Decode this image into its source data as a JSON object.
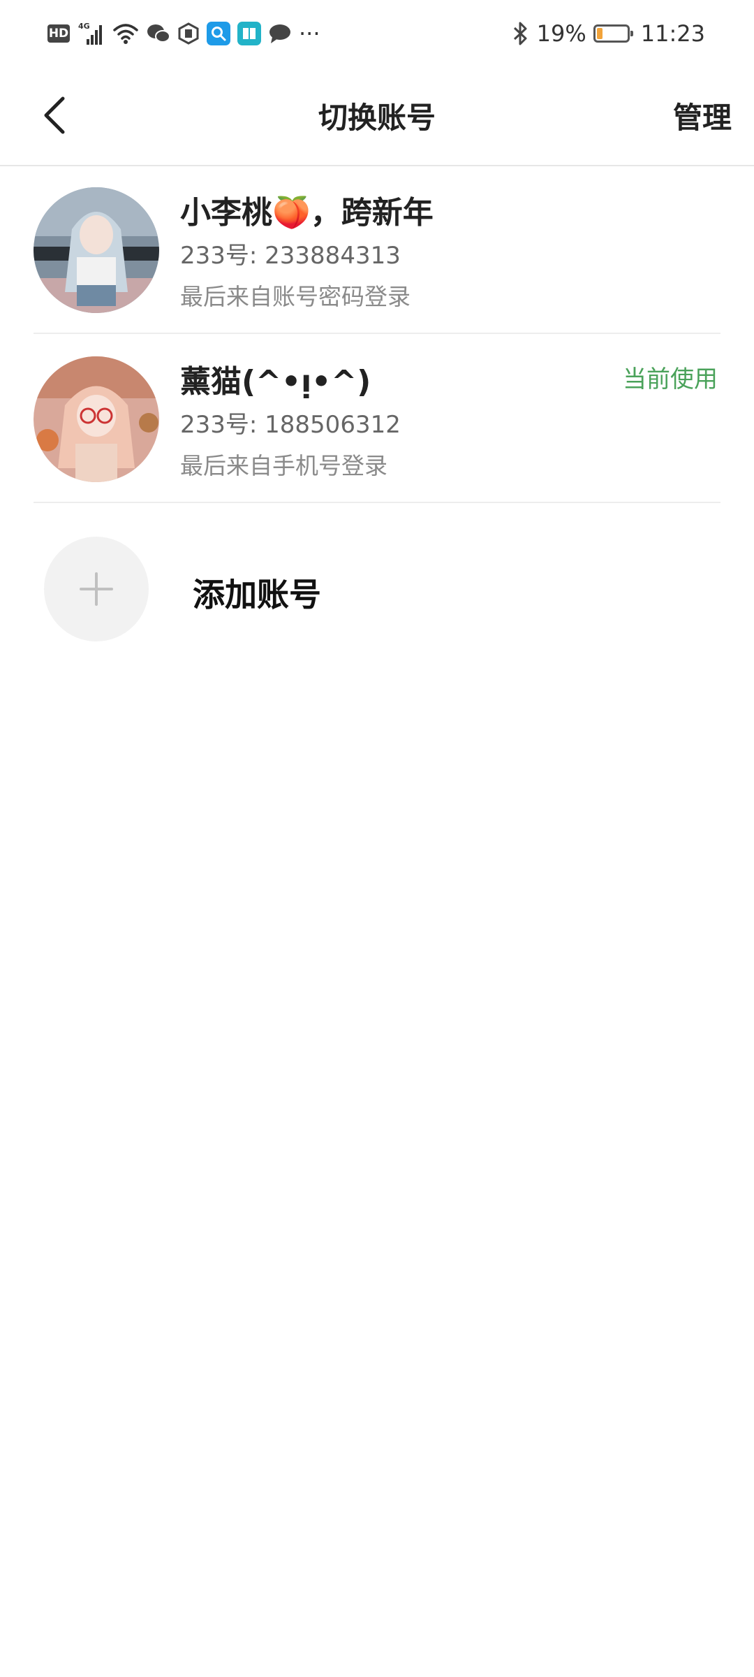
{
  "status_bar": {
    "network": "4G",
    "battery_percent": "19%",
    "battery_level": 0.19,
    "time": "11:23",
    "more": "···"
  },
  "header": {
    "title": "切换账号",
    "manage": "管理"
  },
  "accounts": [
    {
      "name": "小李桃🍑，跨新年",
      "id": "233号: 233884313",
      "last_login": "最后来自账号密码登录",
      "badge": ""
    },
    {
      "name": "薰猫(^•ᴉ•^)",
      "id": "233号: 188506312",
      "last_login": "最后来自手机号登录",
      "badge": "当前使用"
    }
  ],
  "add_account": {
    "label": "添加账号"
  },
  "colors": {
    "accent_green": "#4aa25a",
    "battery_orange": "#f2a33a"
  }
}
